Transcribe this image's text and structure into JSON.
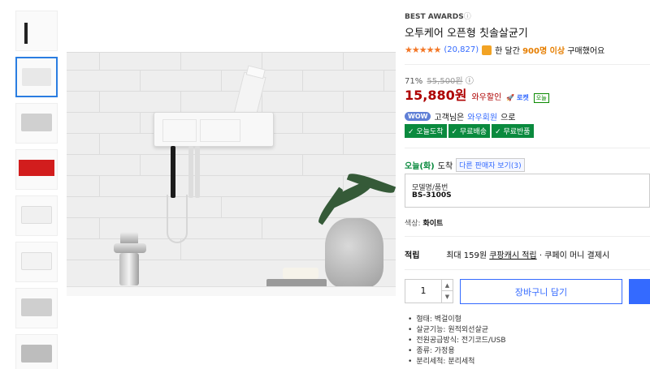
{
  "product": {
    "awards": "BEST AWARDS",
    "title": "오투케어 오픈형 칫솔살균기",
    "rating_stars": "★★★★★",
    "review_count": "(20,827)",
    "purchased_prefix": "한 달간",
    "purchased_count": "900명 이상",
    "purchased_suffix": "구매했어요",
    "discount_rate": "71%",
    "original_price": "55,500원",
    "price": "15,880원",
    "price_label": "와우할인",
    "rocket_label": "로켓",
    "today_badge": "오늘",
    "wow": {
      "pill": "WOW",
      "pre": "고객님은",
      "link": "와우회원",
      "post": "으로"
    },
    "badges": [
      "✓ 오늘도착",
      "✓ 무료배송",
      "✓ 무료반품"
    ],
    "delivery": {
      "today": "오늘(화)",
      "arrive": "도착",
      "other_sellers": "다른 판매자 보기(3)"
    },
    "option": {
      "label": "모델명/품번",
      "value": "BS-3100S"
    },
    "color": {
      "label": "색상:",
      "value": "화이트"
    },
    "points": {
      "label": "적립",
      "text_pre": "최대 159원",
      "link": "쿠팡캐시 적립",
      "text_post": "· 쿠페이 머니 결제시"
    },
    "quantity": "1",
    "cart_button": "장바구니 담기",
    "specs": [
      "형태: 벽걸이형",
      "살균기능: 원적외선살균",
      "전원공급방식: 전기코드/USB",
      "종류: 가정용",
      "분리세척: 분리세척"
    ]
  },
  "colors": {
    "accent": "#346aff",
    "price": "#ae0000",
    "star": "#f37726",
    "green": "#0a8a3e"
  }
}
